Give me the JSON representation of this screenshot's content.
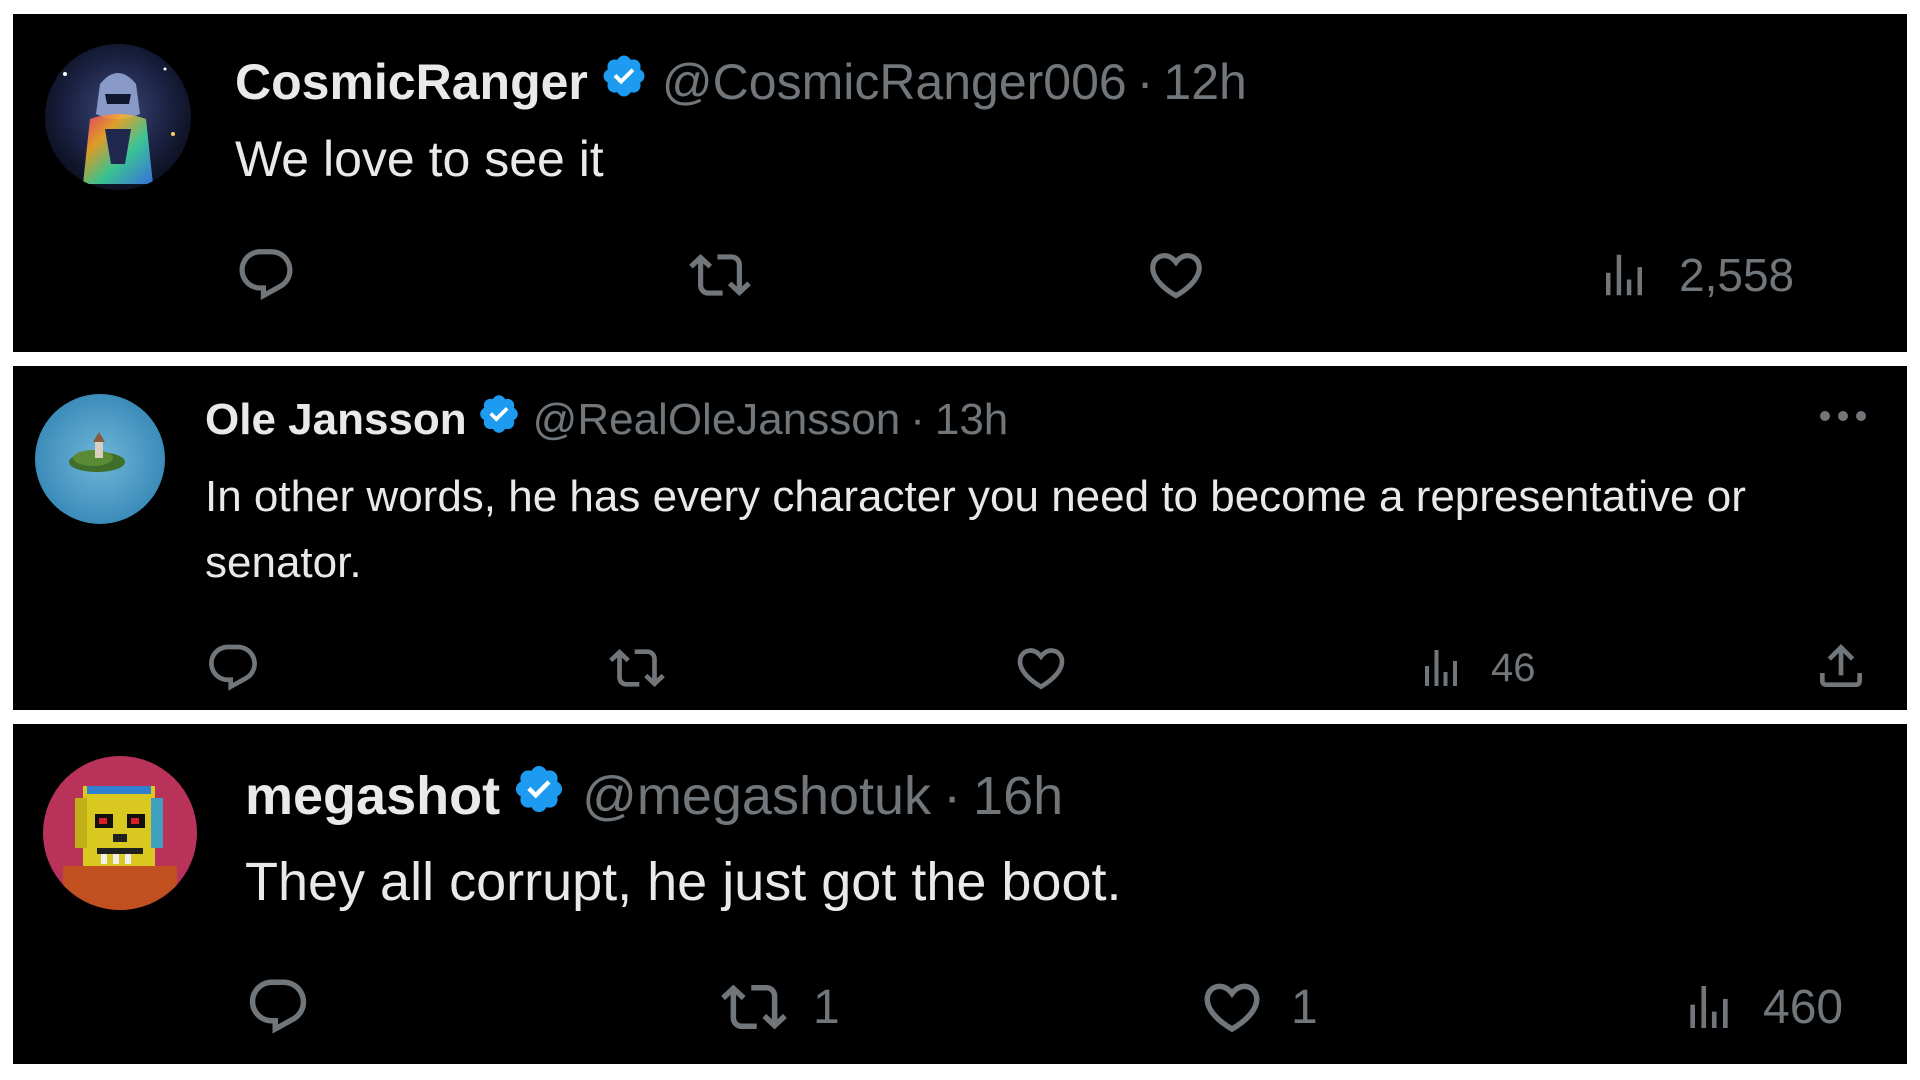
{
  "colors": {
    "background": "#000000",
    "text": "#e7e9ea",
    "muted": "#71767b",
    "verified": "#1d9bf0",
    "separator": "#ffffff"
  },
  "tweets": [
    {
      "name": "CosmicRanger",
      "handle": "@CosmicRanger006",
      "separator": "·",
      "time": "12h",
      "verified": true,
      "text": "We love to see it",
      "avatar_icon": "avatar-cosmic-armor",
      "actions": {
        "reply": {
          "icon": "reply-icon",
          "count": ""
        },
        "retweet": {
          "icon": "retweet-icon",
          "count": ""
        },
        "like": {
          "icon": "heart-icon",
          "count": ""
        },
        "views": {
          "icon": "views-chart-icon",
          "count": "2,558"
        }
      }
    },
    {
      "name": "Ole Jansson",
      "handle": "@RealOleJansson",
      "separator": "·",
      "time": "13h",
      "verified": true,
      "text": "In other words, he has every character you need to become a representative or senator.",
      "avatar_icon": "avatar-island-lake",
      "actions": {
        "reply": {
          "icon": "reply-icon",
          "count": ""
        },
        "retweet": {
          "icon": "retweet-icon",
          "count": ""
        },
        "like": {
          "icon": "heart-icon",
          "count": ""
        },
        "views": {
          "icon": "views-chart-icon",
          "count": "46"
        },
        "share": {
          "icon": "share-icon"
        }
      },
      "more_icon": "more-dots-icon"
    },
    {
      "name": "megashot",
      "handle": "@megashotuk",
      "separator": "·",
      "time": "16h",
      "verified": true,
      "text": "They all corrupt, he just got the boot.",
      "avatar_icon": "avatar-pixel-skull",
      "actions": {
        "reply": {
          "icon": "reply-icon",
          "count": ""
        },
        "retweet": {
          "icon": "retweet-icon",
          "count": "1"
        },
        "like": {
          "icon": "heart-icon",
          "count": "1"
        },
        "views": {
          "icon": "views-chart-icon",
          "count": "460"
        }
      }
    }
  ]
}
